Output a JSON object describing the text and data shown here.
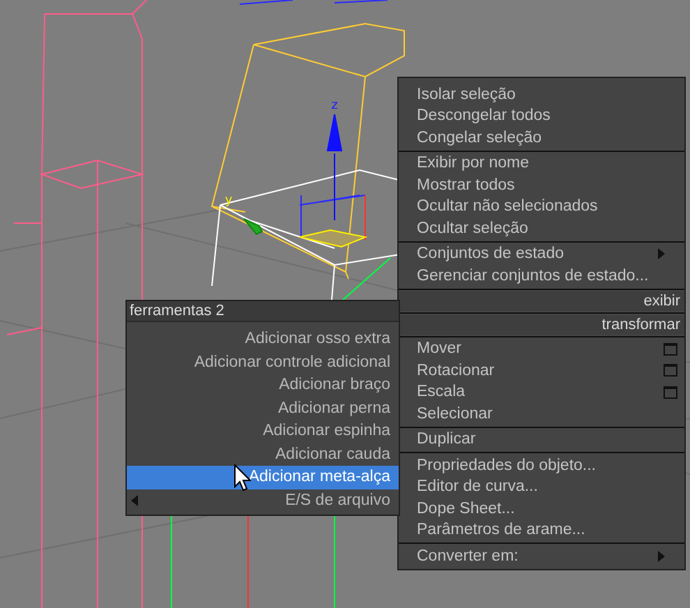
{
  "viewport": {
    "axis_labels": [
      "z",
      "y"
    ]
  },
  "quad_menu": {
    "groups": [
      {
        "kind": "items",
        "items": [
          {
            "label": "Isolar seleção",
            "submenu": false,
            "options": false
          },
          {
            "label": "Descongelar todos",
            "submenu": false,
            "options": false
          },
          {
            "label": "Congelar seleção",
            "submenu": false,
            "options": false
          }
        ]
      },
      {
        "kind": "items",
        "items": [
          {
            "label": "Exibir por nome",
            "submenu": false,
            "options": false
          },
          {
            "label": "Mostrar todos",
            "submenu": false,
            "options": false
          },
          {
            "label": "Ocultar não selecionados",
            "submenu": false,
            "options": false
          },
          {
            "label": "Ocultar seleção",
            "submenu": false,
            "options": false
          }
        ]
      },
      {
        "kind": "items",
        "items": [
          {
            "label": "Conjuntos de estado",
            "submenu": true,
            "options": false
          },
          {
            "label": "Gerenciar conjuntos de estado...",
            "submenu": false,
            "options": false
          }
        ]
      },
      {
        "kind": "header",
        "label": "exibir"
      },
      {
        "kind": "header",
        "label": "transformar"
      },
      {
        "kind": "items",
        "items": [
          {
            "label": "Mover",
            "submenu": false,
            "options": true
          },
          {
            "label": "Rotacionar",
            "submenu": false,
            "options": true
          },
          {
            "label": "Escala",
            "submenu": false,
            "options": true
          },
          {
            "label": "Selecionar",
            "submenu": false,
            "options": false
          }
        ]
      },
      {
        "kind": "items",
        "items": [
          {
            "label": "Duplicar",
            "submenu": false,
            "options": false
          }
        ]
      },
      {
        "kind": "items",
        "items": [
          {
            "label": "Propriedades do objeto...",
            "submenu": false,
            "options": false
          },
          {
            "label": "Editor de curva...",
            "submenu": false,
            "options": false
          },
          {
            "label": "Dope Sheet...",
            "submenu": false,
            "options": false
          },
          {
            "label": "Parâmetros de arame...",
            "submenu": false,
            "options": false
          }
        ]
      },
      {
        "kind": "items",
        "items": [
          {
            "label": "Converter em:",
            "submenu": true,
            "options": false
          }
        ]
      }
    ]
  },
  "tools_menu": {
    "title": "ferramentas 2",
    "items": [
      {
        "label": "Adicionar osso extra",
        "selected": false,
        "submenu": false
      },
      {
        "label": "Adicionar controle adicional",
        "selected": false,
        "submenu": false
      },
      {
        "label": "Adicionar braço",
        "selected": false,
        "submenu": false
      },
      {
        "label": "Adicionar perna",
        "selected": false,
        "submenu": false
      },
      {
        "label": "Adicionar espinha",
        "selected": false,
        "submenu": false
      },
      {
        "label": "Adicionar cauda",
        "selected": false,
        "submenu": false
      },
      {
        "label": "Adicionar meta-alça",
        "selected": true,
        "submenu": false
      },
      {
        "label": "E/S de arquivo",
        "selected": false,
        "submenu": true
      }
    ]
  }
}
